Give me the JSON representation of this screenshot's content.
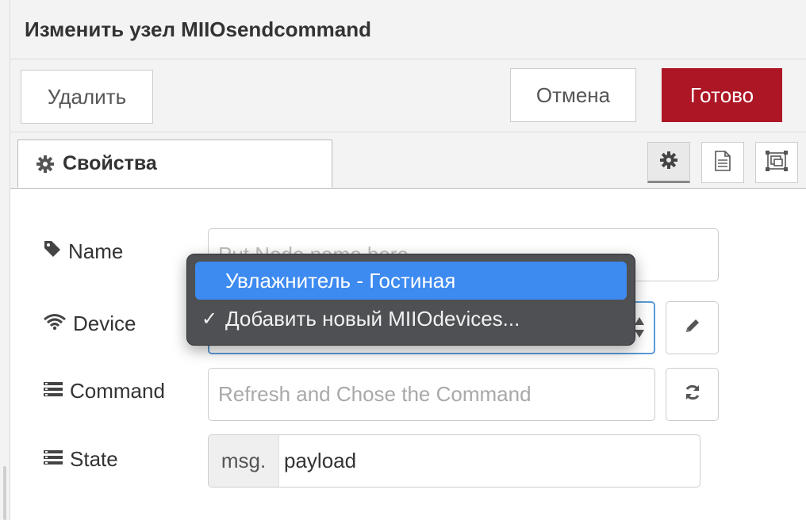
{
  "header": {
    "title": "Изменить узел MIIOsendcommand"
  },
  "toolbar": {
    "delete_label": "Удалить",
    "cancel_label": "Отмена",
    "done_label": "Готово",
    "done_color": "#ad1625"
  },
  "tabs": {
    "properties_label": "Свойства"
  },
  "side_buttons": [
    "gear-icon",
    "document-icon",
    "frame-icon"
  ],
  "form": {
    "name": {
      "label": "Name",
      "placeholder": "Put Node name here",
      "value": ""
    },
    "device": {
      "label": "Device",
      "options": [
        {
          "label": "Увлажнитель - Гостиная",
          "highlighted": true,
          "checked": false
        },
        {
          "label": "Добавить новый MIIOdevices...",
          "highlighted": false,
          "checked": true
        }
      ]
    },
    "command": {
      "label": "Command",
      "placeholder": "Refresh and Chose the Command"
    },
    "state": {
      "label": "State",
      "prefix": "msg.",
      "value": "payload"
    }
  },
  "colors": {
    "accent_blue": "#3d8af0",
    "focus_border": "#5b9bd5",
    "dropdown_bg": "#4e5054"
  }
}
